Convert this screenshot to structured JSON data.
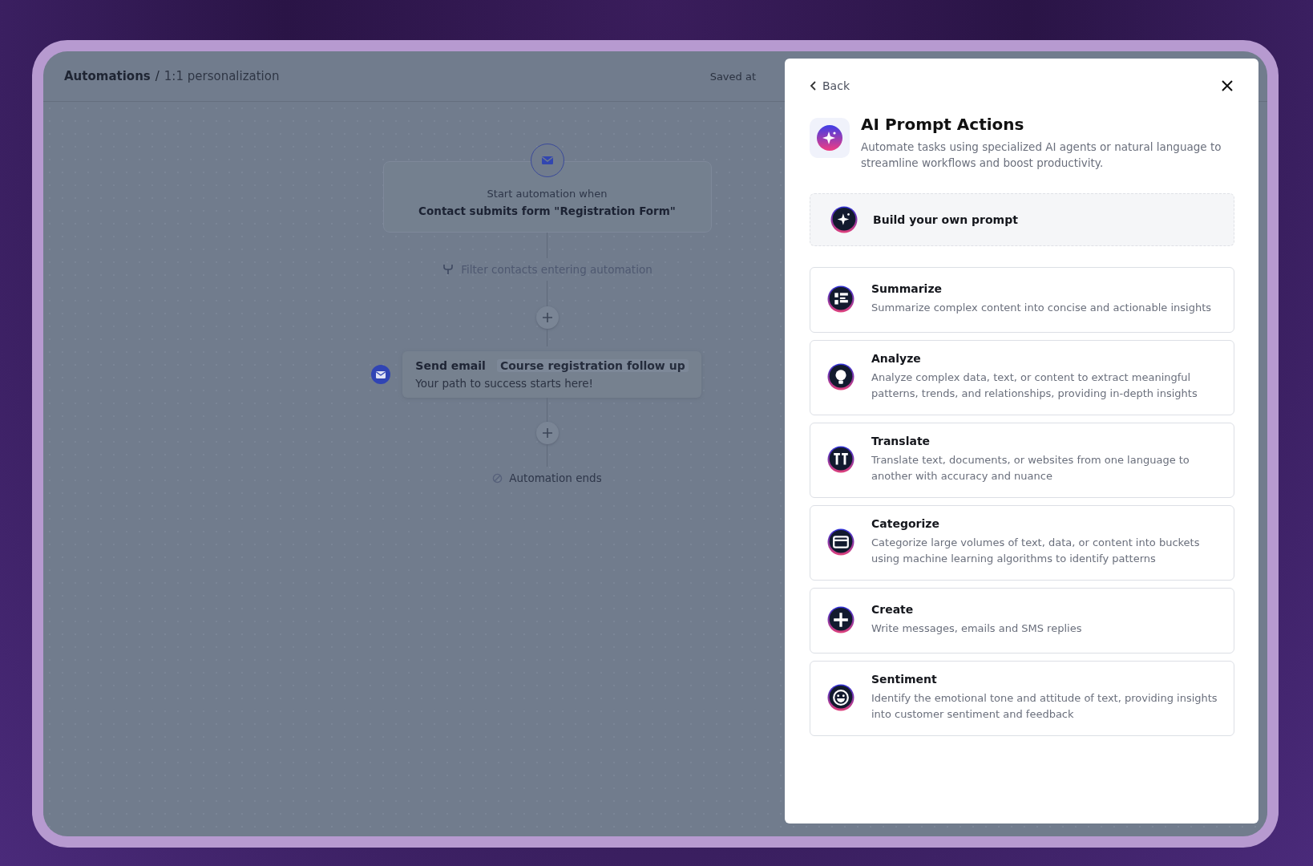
{
  "breadcrumb": {
    "root": "Automations",
    "separator": "/",
    "current": "1:1 personalization"
  },
  "save_status": "Saved at",
  "flow": {
    "trigger": {
      "label": "Start automation when",
      "value": "Contact submits form \"Registration Form\""
    },
    "filter": "Filter contacts entering automation",
    "action": {
      "title": "Send email",
      "name": "Course registration follow up",
      "subject": "Your path to success starts here!"
    },
    "end": "Automation ends"
  },
  "panel": {
    "back": "Back",
    "title": "AI Prompt Actions",
    "description": "Automate tasks using specialized AI agents or natural language to streamline workflows and boost productivity.",
    "custom_prompt": "Build your own prompt",
    "actions": [
      {
        "kind": "summarize",
        "title": "Summarize",
        "description": "Summarize complex content into concise and actionable insights"
      },
      {
        "kind": "analyze",
        "title": "Analyze",
        "description": "Analyze complex data, text, or content to extract meaningful patterns, trends, and relationships, providing in-depth insights"
      },
      {
        "kind": "translate",
        "title": "Translate",
        "description": "Translate text, documents, or websites from one language to another with accuracy and nuance"
      },
      {
        "kind": "categorize",
        "title": "Categorize",
        "description": "Categorize large volumes of text, data, or content into buckets using machine learning algorithms to identify patterns"
      },
      {
        "kind": "create",
        "title": "Create",
        "description": "Write messages, emails and SMS replies"
      },
      {
        "kind": "sentiment",
        "title": "Sentiment",
        "description": "Identify the emotional tone and attitude of text, providing insights into customer sentiment and feedback"
      }
    ]
  }
}
